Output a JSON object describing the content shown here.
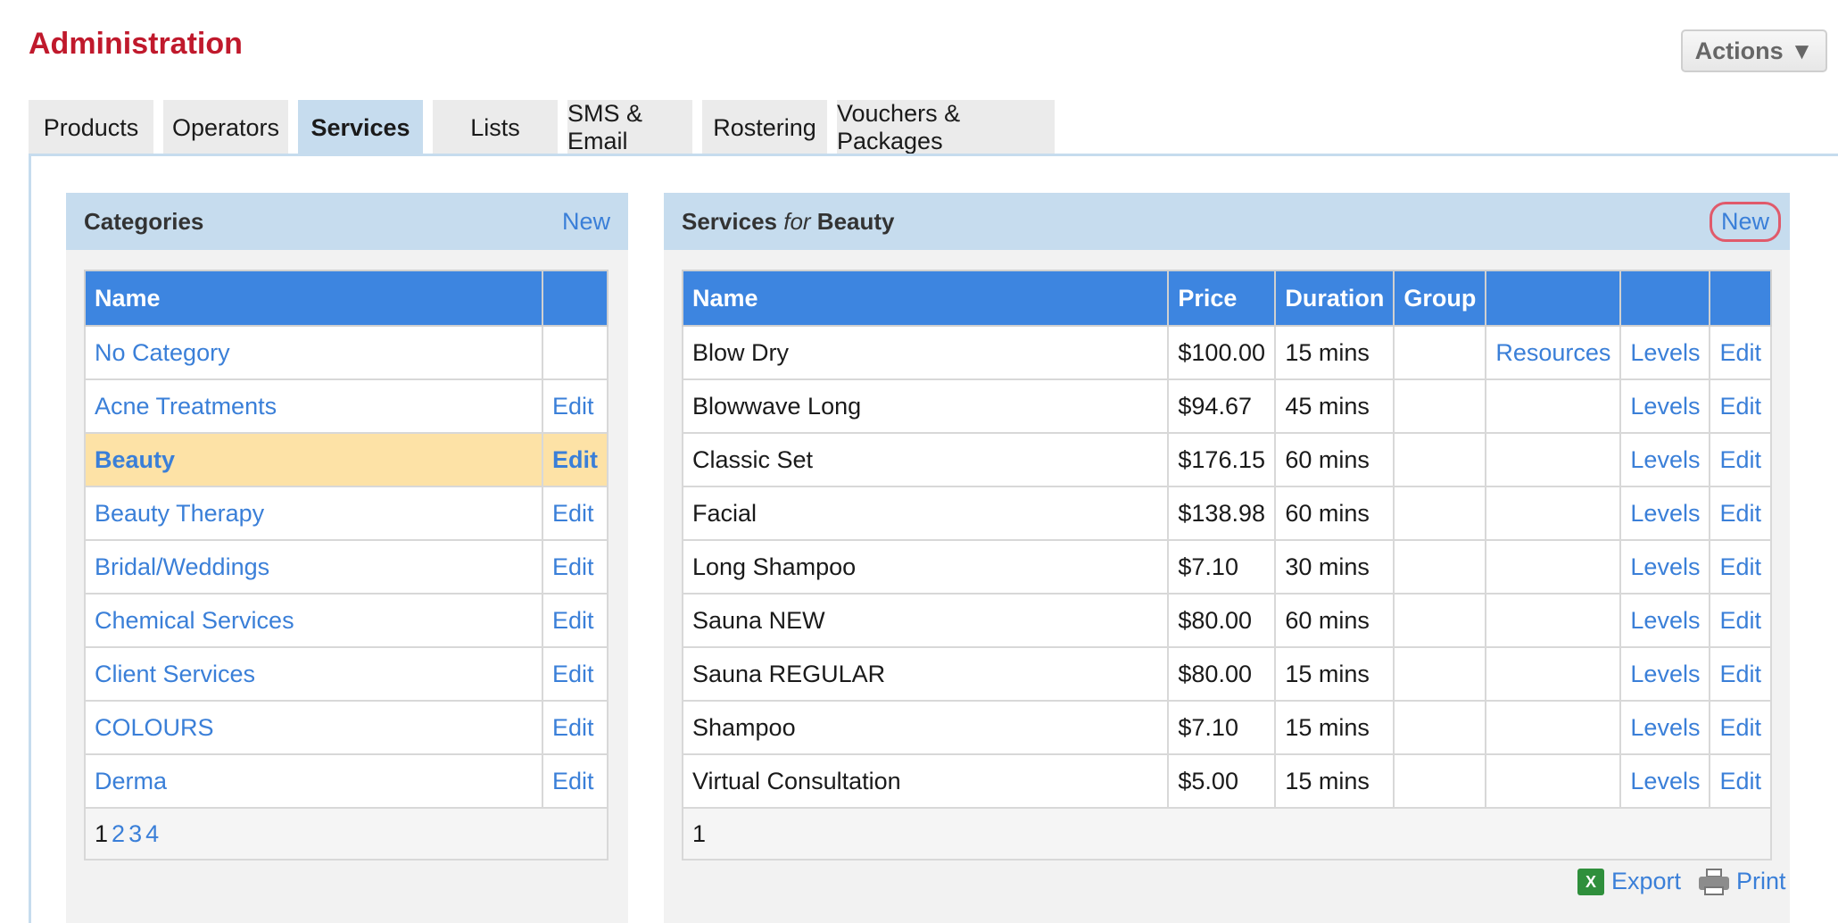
{
  "header": {
    "title": "Administration",
    "actions_label": "Actions"
  },
  "tabs": [
    {
      "label": "Products"
    },
    {
      "label": "Operators"
    },
    {
      "label": "Services",
      "active": true
    },
    {
      "label": "Lists"
    },
    {
      "label": "SMS & Email"
    },
    {
      "label": "Rostering"
    },
    {
      "label": "Vouchers & Packages"
    }
  ],
  "categories": {
    "title": "Categories",
    "new_label": "New",
    "columns": [
      "Name",
      ""
    ],
    "rows": [
      {
        "name": "No Category",
        "edit": ""
      },
      {
        "name": "Acne Treatments",
        "edit": "Edit"
      },
      {
        "name": "Beauty",
        "edit": "Edit",
        "selected": true
      },
      {
        "name": "Beauty Therapy",
        "edit": "Edit"
      },
      {
        "name": "Bridal/Weddings",
        "edit": "Edit"
      },
      {
        "name": "Chemical Services",
        "edit": "Edit"
      },
      {
        "name": "Client Services",
        "edit": "Edit"
      },
      {
        "name": "COLOURS",
        "edit": "Edit"
      },
      {
        "name": "Derma",
        "edit": "Edit"
      }
    ],
    "pages": [
      "1",
      "2",
      "3",
      "4"
    ],
    "current_page": "1"
  },
  "services": {
    "title_prefix": "Services",
    "title_for": "for",
    "title_category": "Beauty",
    "new_label": "New",
    "columns": [
      "Name",
      "Price",
      "Duration",
      "Group",
      "",
      "",
      ""
    ],
    "rows": [
      {
        "name": "Blow Dry",
        "price": "$100.00",
        "duration": "15 mins",
        "group": "",
        "resources": "Resources",
        "levels": "Levels",
        "edit": "Edit"
      },
      {
        "name": "Blowwave Long",
        "price": "$94.67",
        "duration": "45 mins",
        "group": "",
        "resources": "",
        "levels": "Levels",
        "edit": "Edit"
      },
      {
        "name": "Classic Set",
        "price": "$176.15",
        "duration": "60 mins",
        "group": "",
        "resources": "",
        "levels": "Levels",
        "edit": "Edit"
      },
      {
        "name": "Facial",
        "price": "$138.98",
        "duration": "60 mins",
        "group": "",
        "resources": "",
        "levels": "Levels",
        "edit": "Edit"
      },
      {
        "name": "Long Shampoo",
        "price": "$7.10",
        "duration": "30 mins",
        "group": "",
        "resources": "",
        "levels": "Levels",
        "edit": "Edit"
      },
      {
        "name": "Sauna NEW",
        "price": "$80.00",
        "duration": "60 mins",
        "group": "",
        "resources": "",
        "levels": "Levels",
        "edit": "Edit"
      },
      {
        "name": "Sauna REGULAR",
        "price": "$80.00",
        "duration": "15 mins",
        "group": "",
        "resources": "",
        "levels": "Levels",
        "edit": "Edit"
      },
      {
        "name": "Shampoo",
        "price": "$7.10",
        "duration": "15 mins",
        "group": "",
        "resources": "",
        "levels": "Levels",
        "edit": "Edit"
      },
      {
        "name": "Virtual Consultation",
        "price": "$5.00",
        "duration": "15 mins",
        "group": "",
        "resources": "",
        "levels": "Levels",
        "edit": "Edit"
      }
    ],
    "pages": [
      "1"
    ],
    "export_label": "Export",
    "print_label": "Print"
  },
  "icons": {
    "export": "excel-icon",
    "print": "printer-icon",
    "actions_caret": "caret-down-icon"
  },
  "colors": {
    "title": "#c0192c",
    "link": "#3a7fd8",
    "table_header": "#3d85e0",
    "panel_header": "#c6dcee",
    "selected_row": "#fde2a6",
    "highlight_circle": "#e05a6b"
  }
}
